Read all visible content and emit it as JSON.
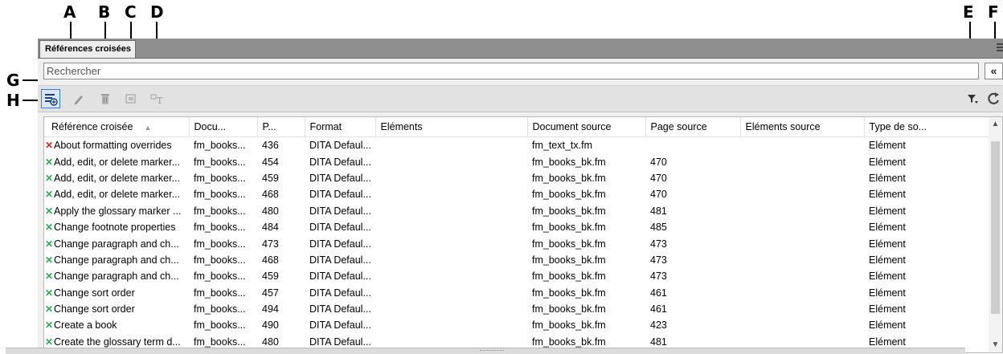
{
  "callouts": {
    "a": "A",
    "b": "B",
    "c": "C",
    "d": "D",
    "e": "E",
    "f": "F",
    "g": "G",
    "h": "H"
  },
  "panel": {
    "tab_label": "Références croisées",
    "search_placeholder": "Rechercher",
    "collapse_glyph": "«"
  },
  "toolbar": {
    "left_icons": [
      "new-xref-icon",
      "edit-pencil-icon",
      "delete-trash-icon",
      "convert-icon",
      "text-convert-icon"
    ],
    "right_icons": [
      "filter-icon",
      "refresh-icon"
    ]
  },
  "table": {
    "columns": [
      "Référence croisée",
      "Docu...",
      "P...",
      "Format",
      "Eléments",
      "Document source",
      "Page source",
      "Eléments source",
      "Type de so..."
    ],
    "rows": [
      {
        "status": "red",
        "ref": "About formatting overrides",
        "doc": "fm_books...",
        "page": "436",
        "format": "DITA Defaul...",
        "elements": "",
        "src_doc": "fm_text_tx.fm",
        "src_page": "",
        "src_elements": "",
        "type": "Elément"
      },
      {
        "status": "green",
        "ref": "Add, edit, or delete marker...",
        "doc": "fm_books...",
        "page": "454",
        "format": "DITA Defaul...",
        "elements": "",
        "src_doc": "fm_books_bk.fm",
        "src_page": "470",
        "src_elements": "",
        "type": "Elément"
      },
      {
        "status": "green",
        "ref": "Add, edit, or delete marker...",
        "doc": "fm_books...",
        "page": "459",
        "format": "DITA Defaul...",
        "elements": "",
        "src_doc": "fm_books_bk.fm",
        "src_page": "470",
        "src_elements": "",
        "type": "Elément"
      },
      {
        "status": "green",
        "ref": "Add, edit, or delete marker...",
        "doc": "fm_books...",
        "page": "468",
        "format": "DITA Defaul...",
        "elements": "",
        "src_doc": "fm_books_bk.fm",
        "src_page": "470",
        "src_elements": "",
        "type": "Elément"
      },
      {
        "status": "green",
        "ref": "Apply the glossary marker ...",
        "doc": "fm_books...",
        "page": "480",
        "format": "DITA Defaul...",
        "elements": "",
        "src_doc": "fm_books_bk.fm",
        "src_page": "481",
        "src_elements": "",
        "type": "Elément"
      },
      {
        "status": "green",
        "ref": "Change footnote properties",
        "doc": "fm_books...",
        "page": "484",
        "format": "DITA Defaul...",
        "elements": "",
        "src_doc": "fm_books_bk.fm",
        "src_page": "485",
        "src_elements": "",
        "type": "Elément"
      },
      {
        "status": "green",
        "ref": "Change paragraph and ch...",
        "doc": "fm_books...",
        "page": "473",
        "format": "DITA Defaul...",
        "elements": "",
        "src_doc": "fm_books_bk.fm",
        "src_page": "473",
        "src_elements": "",
        "type": "Elément"
      },
      {
        "status": "green",
        "ref": "Change paragraph and ch...",
        "doc": "fm_books...",
        "page": "468",
        "format": "DITA Defaul...",
        "elements": "",
        "src_doc": "fm_books_bk.fm",
        "src_page": "473",
        "src_elements": "",
        "type": "Elément"
      },
      {
        "status": "green",
        "ref": "Change paragraph and ch...",
        "doc": "fm_books...",
        "page": "459",
        "format": "DITA Defaul...",
        "elements": "",
        "src_doc": "fm_books_bk.fm",
        "src_page": "473",
        "src_elements": "",
        "type": "Elément"
      },
      {
        "status": "green",
        "ref": "Change sort order",
        "doc": "fm_books...",
        "page": "457",
        "format": "DITA Defaul...",
        "elements": "",
        "src_doc": "fm_books_bk.fm",
        "src_page": "461",
        "src_elements": "",
        "type": "Elément"
      },
      {
        "status": "green",
        "ref": "Change sort order",
        "doc": "fm_books...",
        "page": "494",
        "format": "DITA Defaul...",
        "elements": "",
        "src_doc": "fm_books_bk.fm",
        "src_page": "461",
        "src_elements": "",
        "type": "Elément"
      },
      {
        "status": "green",
        "ref": "Create a book",
        "doc": "fm_books...",
        "page": "490",
        "format": "DITA Defaul...",
        "elements": "",
        "src_doc": "fm_books_bk.fm",
        "src_page": "423",
        "src_elements": "",
        "type": "Elément"
      },
      {
        "status": "green",
        "ref": "Create the glossary term d...",
        "doc": "fm_books...",
        "page": "480",
        "format": "DITA Defaul...",
        "elements": "",
        "src_doc": "fm_books_bk.fm",
        "src_page": "481",
        "src_elements": "",
        "type": "Elément"
      }
    ]
  },
  "colors": {
    "status_red": "#d62b2b",
    "status_green": "#2fa85a",
    "active_button": "#3a7dd6"
  }
}
